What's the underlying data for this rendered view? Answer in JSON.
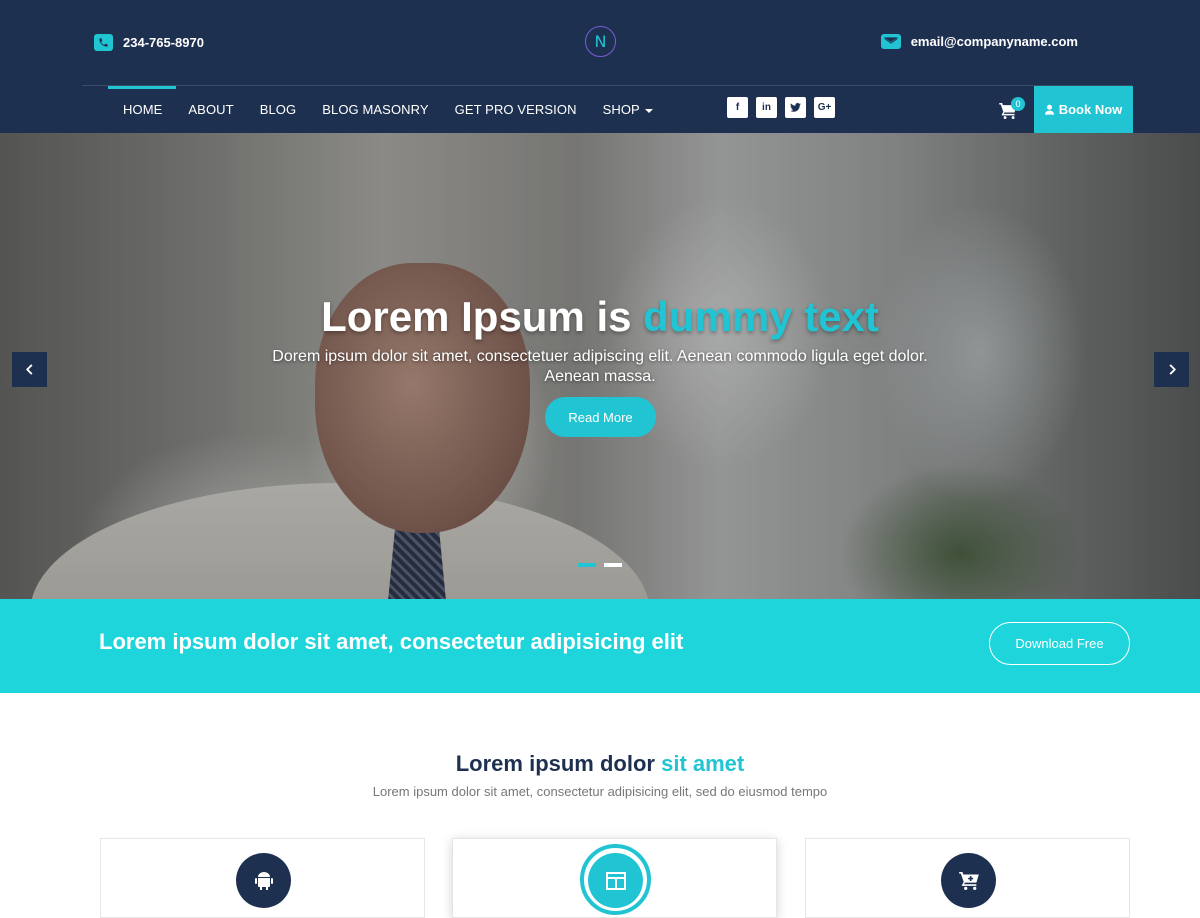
{
  "header": {
    "phone": "234-765-8970",
    "email": "email@companyname.com",
    "logo_letter": "N",
    "nav": [
      {
        "label": "HOME"
      },
      {
        "label": "ABOUT"
      },
      {
        "label": "BLOG"
      },
      {
        "label": "BLOG MASONRY"
      },
      {
        "label": "GET PRO VERSION"
      },
      {
        "label": "SHOP"
      }
    ],
    "social": [
      {
        "icon": "facebook-icon",
        "glyph": "f"
      },
      {
        "icon": "linkedin-icon",
        "glyph": "in"
      },
      {
        "icon": "twitter-icon",
        "glyph": "t"
      },
      {
        "icon": "google-plus-icon",
        "glyph": "G+"
      }
    ],
    "cart_count": "0",
    "book_now": "Book Now"
  },
  "hero": {
    "title_main": "Lorem Ipsum is ",
    "title_accent": "dummy text",
    "subtitle": "Dorem ipsum dolor sit amet, consectetuer adipiscing elit. Aenean commodo ligula eget dolor. Aenean massa.",
    "button": "Read More",
    "slides": 2,
    "active_slide": 1
  },
  "cta": {
    "text": "Lorem ipsum dolor sit amet, consectetur adipisicing elit",
    "button": "Download Free"
  },
  "section": {
    "title_main": "Lorem ipsum dolor ",
    "title_accent": "sit amet",
    "subtitle": "Lorem ipsum dolor sit amet, consectetur adipisicing elit, sed do eiusmod tempo",
    "cards": [
      {
        "icon": "android-icon"
      },
      {
        "icon": "layout-icon"
      },
      {
        "icon": "cart-add-icon"
      }
    ]
  },
  "colors": {
    "navy": "#1e3050",
    "accent": "#20c4d3",
    "cta_bg": "#1dd5da"
  }
}
